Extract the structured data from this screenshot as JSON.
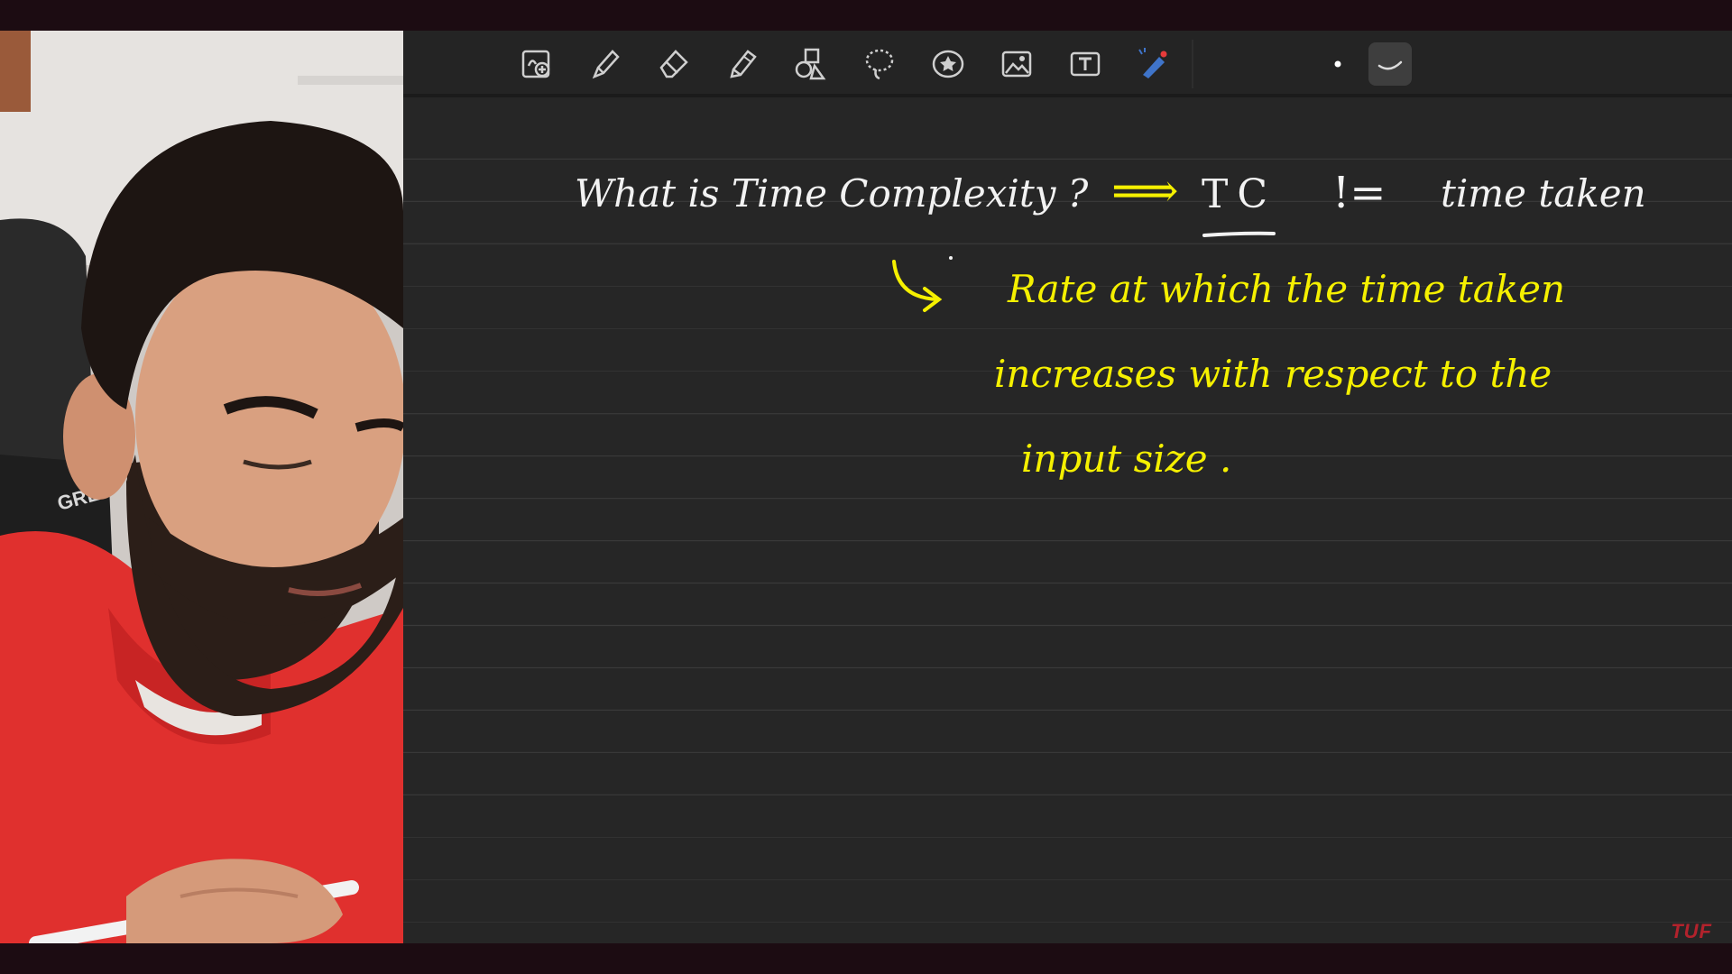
{
  "notes": {
    "line1": {
      "question": "What is Time Complexity ?",
      "arrow": "⟹",
      "abbrev": "TC",
      "not_equal": "!=",
      "meaning": "time taken"
    },
    "definition": {
      "line1": "Rate at which the time taken",
      "line2": "increases with respect to the",
      "line3": "input size ."
    }
  },
  "toolbar": {
    "tools": [
      "add-page-icon",
      "pen-icon",
      "eraser-icon",
      "highlighter-icon",
      "shapes-icon",
      "lasso-icon",
      "sticker-icon",
      "image-icon",
      "text-icon",
      "laser-pointer-icon"
    ],
    "selected_tool": "stroke-style-icon"
  },
  "colors": {
    "ink_white": "#f2f2f2",
    "ink_yellow": "#f5f000",
    "canvas": "#262626",
    "watermark": "#b2222c"
  },
  "brand": {
    "watermark": "TUF",
    "chair_text": "GRE"
  }
}
